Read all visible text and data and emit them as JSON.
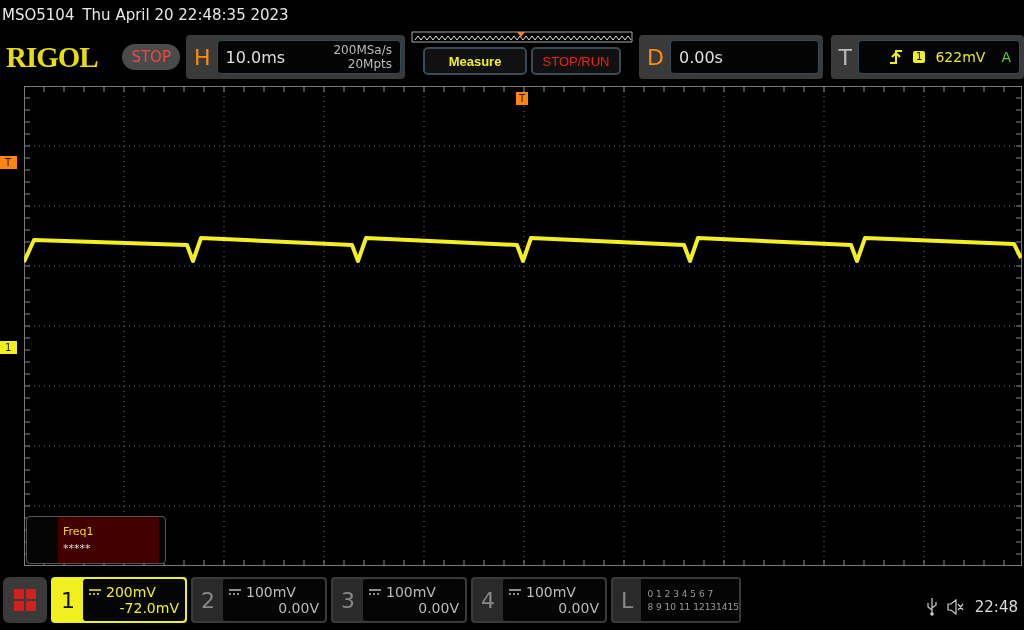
{
  "header": {
    "model": "MSO5104",
    "datetime": "Thu April 20 22:48:35 2023"
  },
  "toolbar": {
    "logo": "RIGOL",
    "run_state": "STOP",
    "horizontal": {
      "label": "H",
      "timebase": "10.0ms",
      "sample_rate": "200MSa/s",
      "memory_depth": "20Mpts"
    },
    "buttons": [
      {
        "label": "Measure",
        "kind": "measure"
      },
      {
        "label": "STOP/RUN",
        "kind": "stoprun"
      }
    ],
    "delay": {
      "label": "D",
      "value": "0.00s"
    },
    "trigger": {
      "label": "T",
      "source": "1",
      "level": "622mV",
      "mode": "A"
    }
  },
  "markers": [
    {
      "label": "T",
      "kind": "trigger-position"
    },
    {
      "label": "T",
      "kind": "trigger-level"
    },
    {
      "label": "1",
      "kind": "channel-offset"
    }
  ],
  "measurement": {
    "name": "Freq1",
    "value": "*****"
  },
  "channels": [
    {
      "number": "1",
      "scale": "200mV",
      "offset": "-72.0mV",
      "selected": true
    },
    {
      "number": "2",
      "scale": "100mV",
      "offset": "0.00V",
      "selected": false
    },
    {
      "number": "3",
      "scale": "100mV",
      "offset": "0.00V",
      "selected": false
    },
    {
      "number": "4",
      "scale": "100mV",
      "offset": "0.00V",
      "selected": false
    }
  ],
  "logic": {
    "label": "L",
    "row_1": "0 1 2 3 4 5 6 7",
    "row_2": "8 9 10 11 12131415"
  },
  "status": {
    "time": "22:48"
  }
}
